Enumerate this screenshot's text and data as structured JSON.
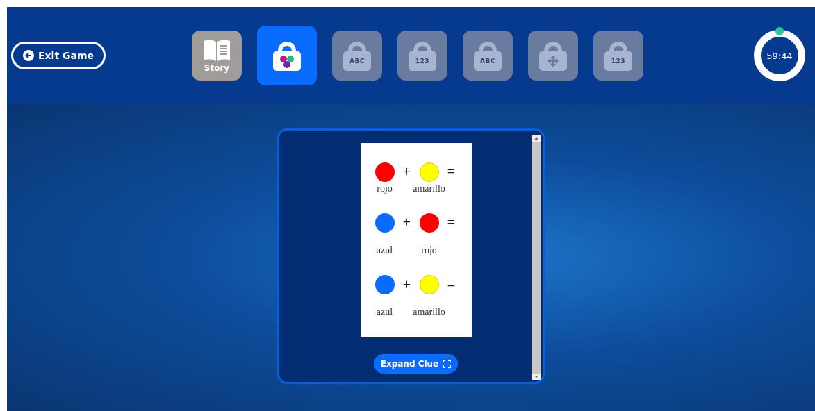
{
  "exit_button": {
    "label": "Exit Game"
  },
  "tabs": [
    {
      "kind": "story",
      "label": "Story",
      "selected": false
    },
    {
      "kind": "colors",
      "selected": true
    },
    {
      "kind": "letters",
      "label": "ABC",
      "selected": false
    },
    {
      "kind": "numbers",
      "label": "123",
      "selected": false
    },
    {
      "kind": "letters",
      "label": "ABC",
      "selected": false
    },
    {
      "kind": "directions",
      "selected": false
    },
    {
      "kind": "numbers",
      "label": "123",
      "selected": false
    }
  ],
  "timer": {
    "time": "59:44"
  },
  "clue": {
    "equations": [
      {
        "left": {
          "color": "#ff0000",
          "name": "rojo"
        },
        "operator": "+",
        "right": {
          "color": "#ffff00",
          "name": "amarillo"
        },
        "result": "="
      },
      {
        "left": {
          "color": "#0a6cff",
          "name": "azul"
        },
        "operator": "+",
        "right": {
          "color": "#ff0000",
          "name": "rojo"
        },
        "result": "="
      },
      {
        "left": {
          "color": "#0a6cff",
          "name": "azul"
        },
        "operator": "+",
        "right": {
          "color": "#ffff00",
          "name": "amarillo"
        },
        "result": "="
      }
    ],
    "expand_button": {
      "label": "Expand Clue"
    }
  }
}
